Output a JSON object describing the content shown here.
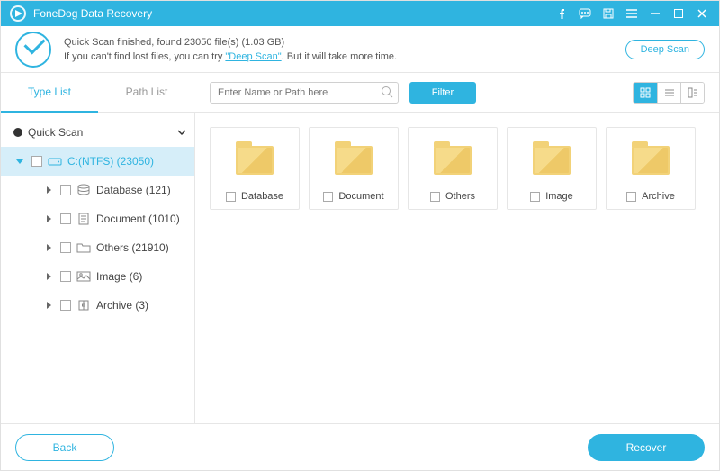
{
  "app": {
    "title": "FoneDog Data Recovery"
  },
  "status": {
    "line1": "Quick Scan finished, found 23050 file(s) (1.03 GB)",
    "line2_prefix": "If you can't find lost files, you can try ",
    "deep_scan_link": "\"Deep Scan\"",
    "line2_suffix": ". But it will take more time.",
    "deep_scan_button": "Deep Scan"
  },
  "tabs": {
    "type_list": "Type List",
    "path_list": "Path List"
  },
  "search": {
    "placeholder": "Enter Name or Path here"
  },
  "filter_button": "Filter",
  "tree": {
    "root_label": "Quick Scan",
    "drive_label": "C:(NTFS) (23050)",
    "children": [
      {
        "label": "Database (121)",
        "icon": "database"
      },
      {
        "label": "Document (1010)",
        "icon": "document"
      },
      {
        "label": "Others (21910)",
        "icon": "folder"
      },
      {
        "label": "Image (6)",
        "icon": "image"
      },
      {
        "label": "Archive (3)",
        "icon": "archive"
      }
    ]
  },
  "folders": [
    {
      "name": "Database"
    },
    {
      "name": "Document"
    },
    {
      "name": "Others"
    },
    {
      "name": "Image"
    },
    {
      "name": "Archive"
    }
  ],
  "footer": {
    "back": "Back",
    "recover": "Recover"
  }
}
